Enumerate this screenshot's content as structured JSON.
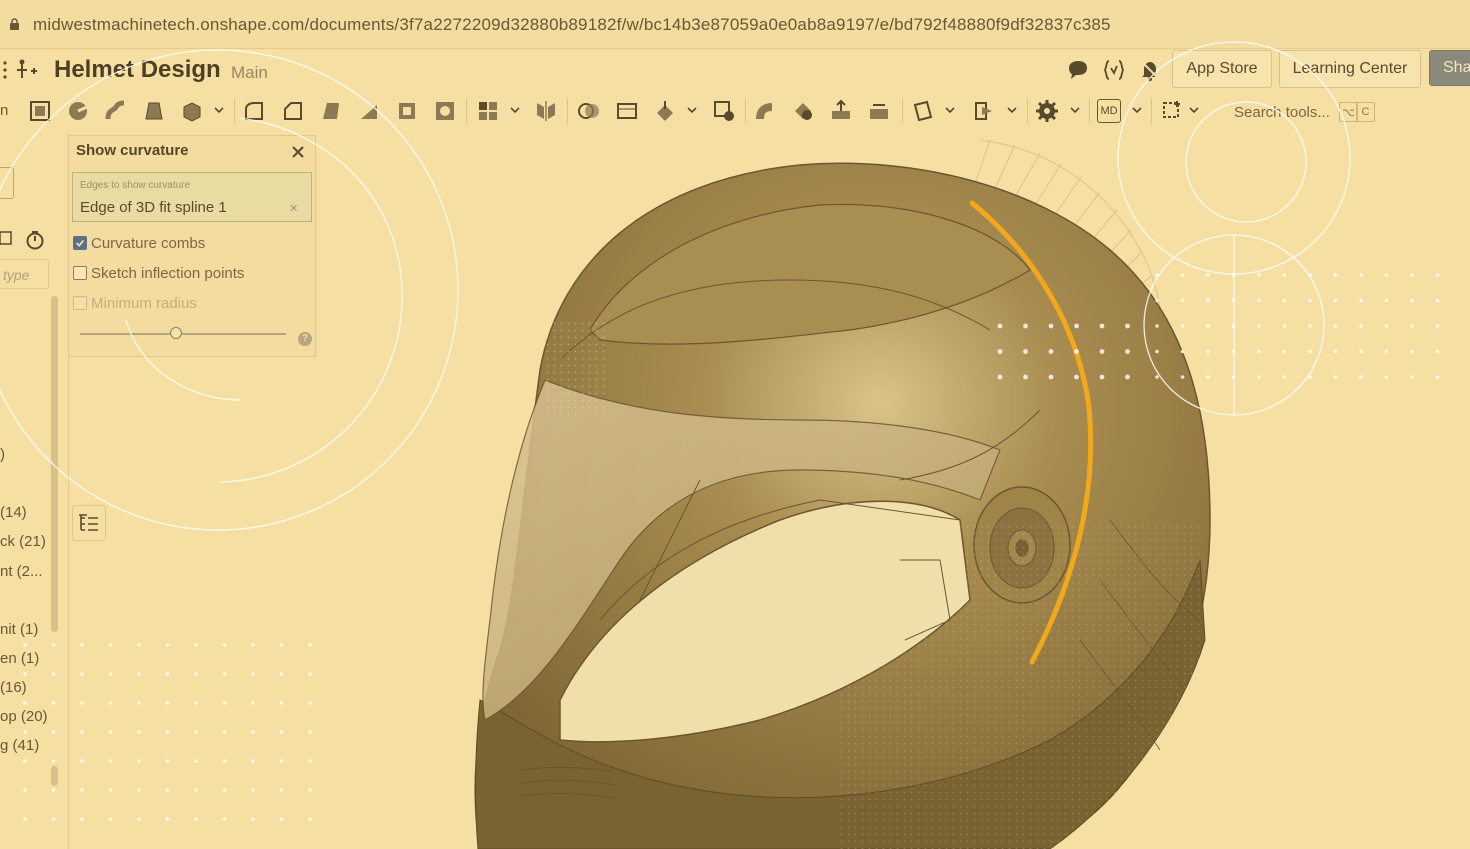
{
  "browser": {
    "url": "midwestmachinetech.onshape.com/documents/3f7a2272209d32880b89182f/w/bc14b3e87059a0e0ab8a9197/e/bd792f48880f9df32837c385"
  },
  "header": {
    "title": "Helmet Design",
    "branch": "Main",
    "buttons": {
      "app_store": "App Store",
      "learning_center": "Learning Center",
      "share": "Sha"
    },
    "icons": [
      "comment-icon",
      "variable-icon",
      "notification-icon"
    ]
  },
  "toolbar": {
    "search_placeholder": "Search tools...",
    "shortcut_key1": "⌥",
    "shortcut_key2": "C",
    "md_label": "MD"
  },
  "left_panel": {
    "filter_placeholder": "type",
    "partial_left_text": "n",
    "items": [
      {
        "label": ")"
      },
      {
        "label": "(14)"
      },
      {
        "label": "ck (21)"
      },
      {
        "label": "nt (2..."
      },
      {
        "label": "nit (1)"
      },
      {
        "label": "en (1)"
      },
      {
        "label": "(16)"
      },
      {
        "label": "op (20)"
      },
      {
        "label": "g (41)"
      }
    ]
  },
  "dialog": {
    "title": "Show curvature",
    "selection_label": "Edges to show curvature",
    "selection_value": "Edge of 3D fit spline 1",
    "selection_clear": "✕",
    "options": [
      {
        "label": "Curvature combs",
        "checked": true
      },
      {
        "label": "Sketch inflection points",
        "checked": false
      },
      {
        "label": "Minimum radius",
        "checked": false
      }
    ],
    "help": "?"
  },
  "colors": {
    "background": "#f6dfa3",
    "helmet": "#9a7f45",
    "curve": "#f2a81d"
  }
}
